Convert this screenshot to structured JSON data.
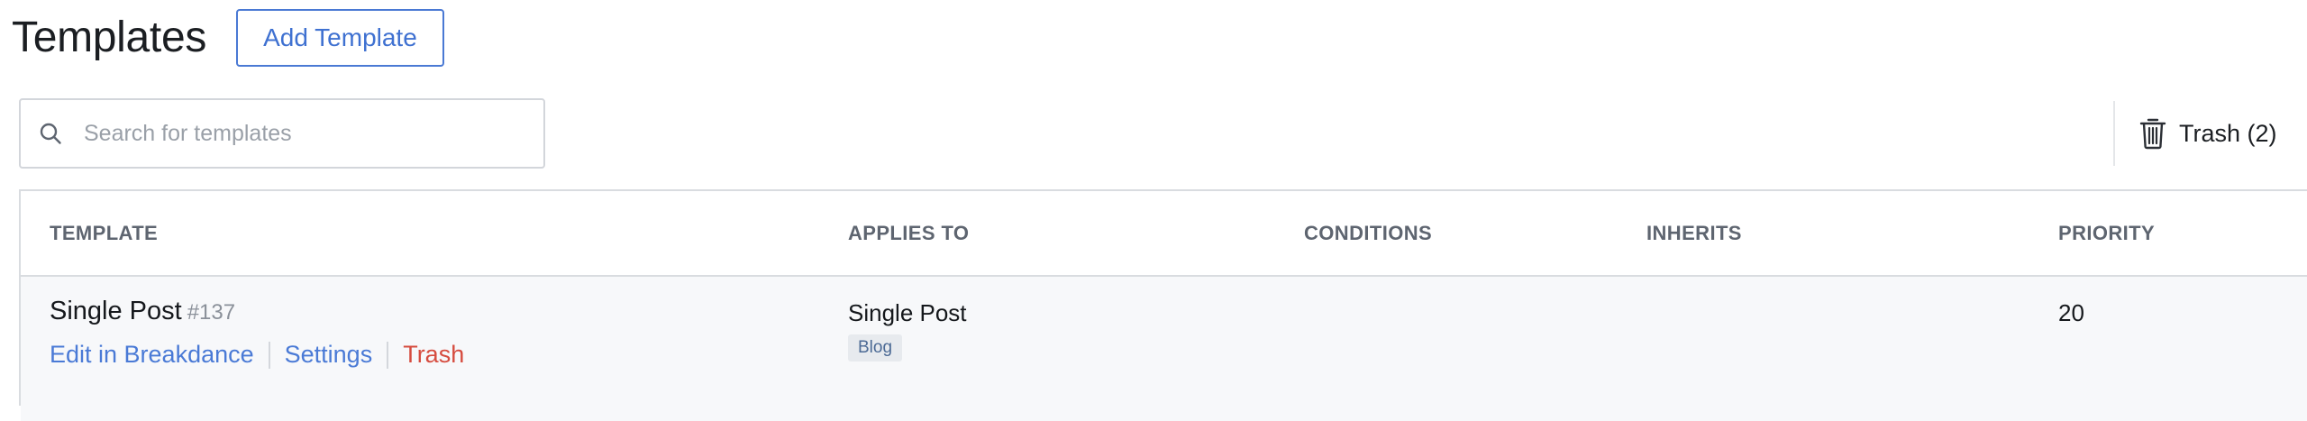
{
  "header": {
    "title": "Templates",
    "add_button_label": "Add Template"
  },
  "search": {
    "placeholder": "Search for templates",
    "value": ""
  },
  "trash": {
    "label": "Trash (2)"
  },
  "table": {
    "columns": [
      "TEMPLATE",
      "APPLIES TO",
      "CONDITIONS",
      "INHERITS",
      "PRIORITY"
    ],
    "rows": [
      {
        "name": "Single Post",
        "id": "#137",
        "actions": [
          "Edit in Breakdance",
          "Settings",
          "Trash"
        ],
        "applies_to": "Single Post",
        "applies_tag": "Blog",
        "conditions": "",
        "inherits": "",
        "priority": "20"
      }
    ]
  },
  "colors": {
    "accent": "#4a7ad6",
    "danger": "#d64c3f",
    "border": "#d9dce0",
    "row_background": "#f7f8fa"
  },
  "icons": {
    "search": "search-icon",
    "trash": "trash-can-icon"
  }
}
